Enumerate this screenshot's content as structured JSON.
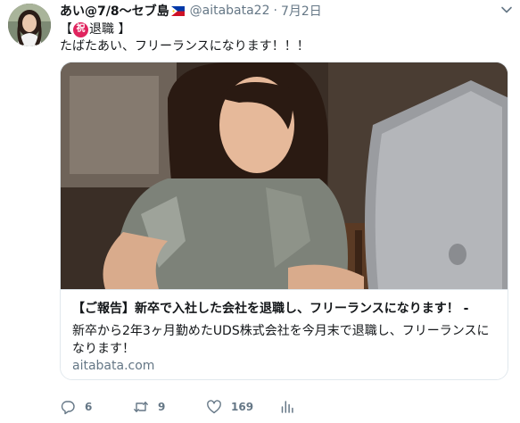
{
  "author": {
    "display_name": "あい@7/8〜セブ島",
    "handle": "@aitabata22",
    "separator": "·",
    "date": "7月2日",
    "flag_icon": "philippines-flag-icon"
  },
  "tweet": {
    "bracket_open": "【",
    "iwai_char": "祝",
    "line1_rest": "退職 】",
    "line2": "たばたあい、フリーランスになります！！！"
  },
  "card": {
    "title": "【ご報告】新卒で入社した会社を退職し、フリーランスになります！ -",
    "description": "新卒から2年3ヶ月勤めたUDS株式会社を今月末で退職し、フリーランスになります！",
    "domain": "aitabata.com"
  },
  "actions": {
    "reply_count": "6",
    "retweet_count": "9",
    "like_count": "169"
  },
  "colors": {
    "text": "#14171a",
    "secondary": "#657786",
    "border": "#e1e8ed",
    "iwai_badge": "#e0245e"
  }
}
